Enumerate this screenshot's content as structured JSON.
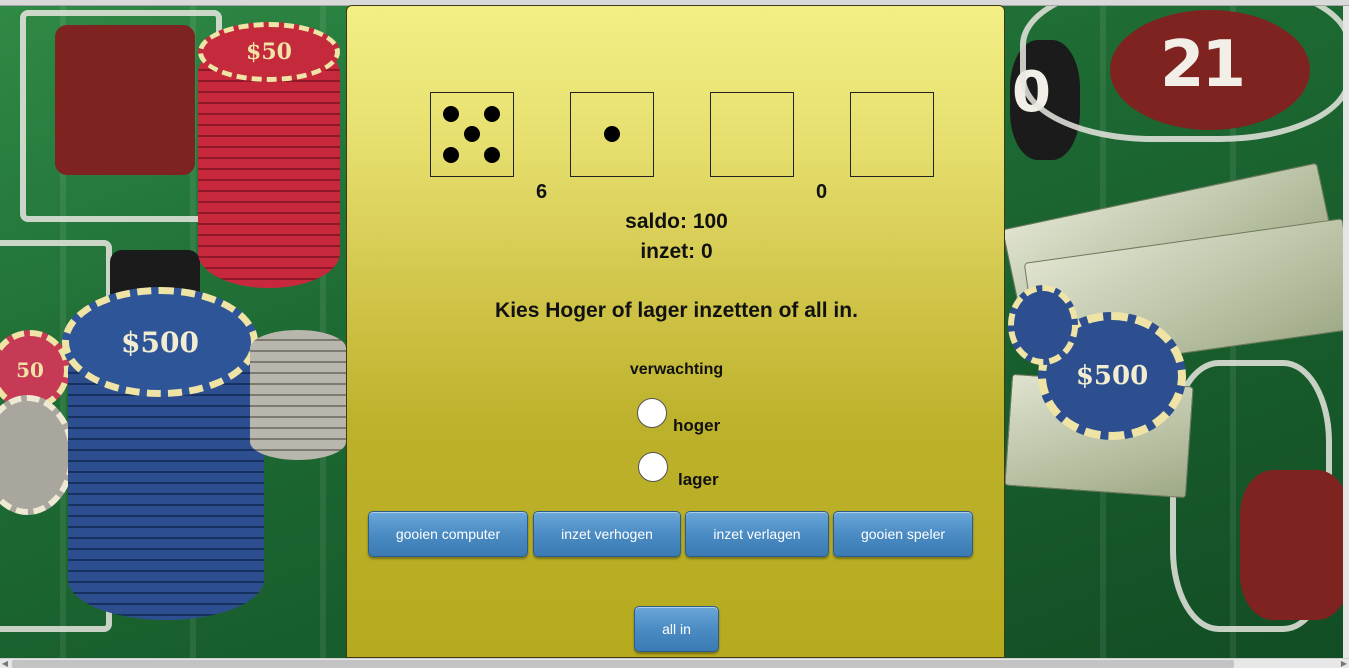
{
  "game": {
    "dice": [
      {
        "name": "computer-die-1",
        "value": 5
      },
      {
        "name": "computer-die-2",
        "value": 1
      },
      {
        "name": "player-die-1",
        "value": 0
      },
      {
        "name": "player-die-2",
        "value": 0
      }
    ],
    "computer_total": "6",
    "player_total": "0",
    "saldo": "saldo: 100",
    "inzet": "inzet: 0",
    "message": "Kies Hoger of lager inzetten of all in.",
    "expectation_heading": "verwachting",
    "options": {
      "higher": "hoger",
      "lower": "lager"
    }
  },
  "buttons": {
    "roll_computer": "gooien computer",
    "raise_bet": "inzet verhogen",
    "lower_bet": "inzet verlagen",
    "roll_player": "gooien speler",
    "all_in": "all in"
  },
  "background": {
    "chip_labels": [
      "$50",
      "$500",
      "50",
      "$500"
    ],
    "table_numbers": [
      "21",
      "0"
    ]
  },
  "colors": {
    "panel_top": "#f3ef86",
    "panel_bottom": "#b6ab1e",
    "button": "#4b8cc4",
    "felt": "#1f6b34"
  }
}
